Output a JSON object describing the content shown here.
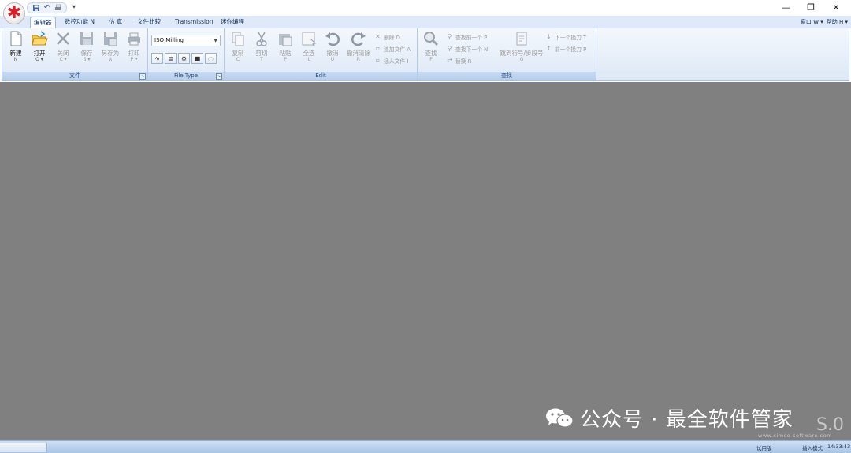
{
  "window": {
    "qat_more": "▾",
    "controls": {
      "minimize": "—",
      "restore": "❐",
      "close": "✕"
    }
  },
  "tabs": [
    {
      "label": "编辑器"
    },
    {
      "label": "数控功能 N"
    },
    {
      "label": "仿 真"
    },
    {
      "label": "文件比较"
    },
    {
      "label": "Transmission"
    },
    {
      "label": "迷你编程"
    }
  ],
  "tabs_right": {
    "window": "窗口 W ▾",
    "help": "帮助 H ▾"
  },
  "ribbon": {
    "file_group": {
      "label": "文件",
      "buttons": [
        {
          "label": "新建",
          "key": "N"
        },
        {
          "label": "打开",
          "key": "O ▾"
        },
        {
          "label": "关闭",
          "key": "C ▾"
        },
        {
          "label": "保存",
          "key": "S ▾"
        },
        {
          "label": "另存为",
          "key": "A"
        },
        {
          "label": "打印",
          "key": "P ▾"
        }
      ]
    },
    "filetype_group": {
      "label": "File Type",
      "combo_value": "ISO Milling"
    },
    "edit_group": {
      "label": "Edit",
      "buttons": [
        {
          "label": "复制",
          "key": "C"
        },
        {
          "label": "剪切",
          "key": "T"
        },
        {
          "label": "粘贴",
          "key": "P"
        },
        {
          "label": "全选",
          "key": "L"
        },
        {
          "label": "撤消",
          "key": "U"
        },
        {
          "label": "撤消清除",
          "key": "R"
        }
      ],
      "small": [
        {
          "label": "删除 D"
        },
        {
          "label": "追加文件 A"
        },
        {
          "label": "插入文件 I"
        }
      ]
    },
    "find_group": {
      "label": "查找",
      "find_button": {
        "label": "查找",
        "key": "F"
      },
      "small_left": [
        {
          "label": "查找前一个 P"
        },
        {
          "label": "查找下一个 N"
        },
        {
          "label": "替换 R"
        }
      ],
      "goto": {
        "label": "跳到行号/步段号",
        "key": "G"
      },
      "small_right": [
        {
          "label": "下一个换刀 T"
        },
        {
          "label": "前一个换刀 P"
        }
      ]
    }
  },
  "watermark": {
    "text": "公众号 · 最全软件管家",
    "version": "S.0",
    "url": "www.cimco-software.com"
  },
  "statusbar": {
    "mode": "试用版",
    "insert": "插入模式",
    "time": "14:33:43"
  }
}
